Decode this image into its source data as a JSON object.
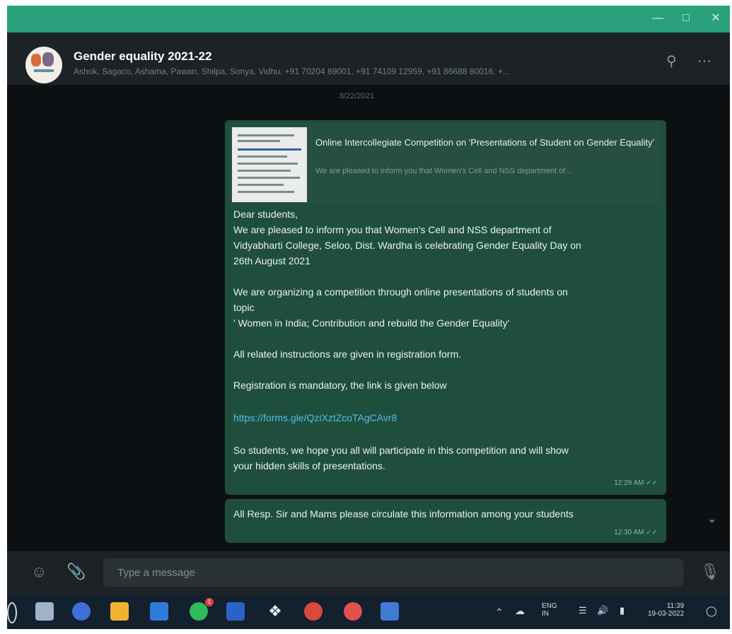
{
  "window": {
    "minimize_icon": "minimize-icon",
    "maximize_icon": "maximize-icon",
    "close_icon": "close-icon",
    "titlebar_color": "#2aa07c"
  },
  "header": {
    "group_name": "Gender equality 2021-22",
    "members": "Ashok, Sagaco, Ashama, Pawan, Shilpa, Sonya, Vidhu, +91 70204 89001, +91 74109 12959, +91 86688 80016, +...",
    "search_icon": "search-icon",
    "menu_icon": "more-options-icon"
  },
  "chat": {
    "date_chip": "8/22/2021",
    "link_preview": {
      "title": "Online Intercollegiate Competition on 'Presentations of Student on Gender Equality'",
      "description": "We are pleased to inform you that Women's Cell and NSS department of..."
    },
    "message1": {
      "lines": [
        "Dear students,",
        "We are pleased to inform you that Women's Cell and NSS department of",
        "Vidyabharti College, Seloo, Dist. Wardha is celebrating Gender Equality Day on",
        "26th August 2021",
        "We are organizing a competition through online presentations of students on",
        "topic",
        "' Women in India; Contribution and rebuild the Gender Equality'",
        "All related instructions are given in registration form.",
        "Registration is mandatory, the link is given below",
        "https://forms.gle/QziXztZcoTAgCAvr8",
        "So students, we hope you all will participate in this competition and will show",
        "your hidden skills of presentations."
      ],
      "time": "12:29 AM"
    },
    "message2": {
      "text": "All Resp. Sir and Mams please circulate this information among your students",
      "time": "12:30 AM"
    },
    "bubble_color": "#1f4e3d",
    "link_color": "#53bdeb"
  },
  "footer": {
    "placeholder": "Type a message",
    "emoji_icon": "emoji-icon",
    "attach_icon": "paperclip-icon",
    "mic_icon": "microphone-icon"
  },
  "taskbar": {
    "lang_top": "ENG",
    "lang_bottom": "IN",
    "clock_time": "11:39",
    "clock_date": "19-03-2022",
    "whatsapp_badge": "1"
  }
}
